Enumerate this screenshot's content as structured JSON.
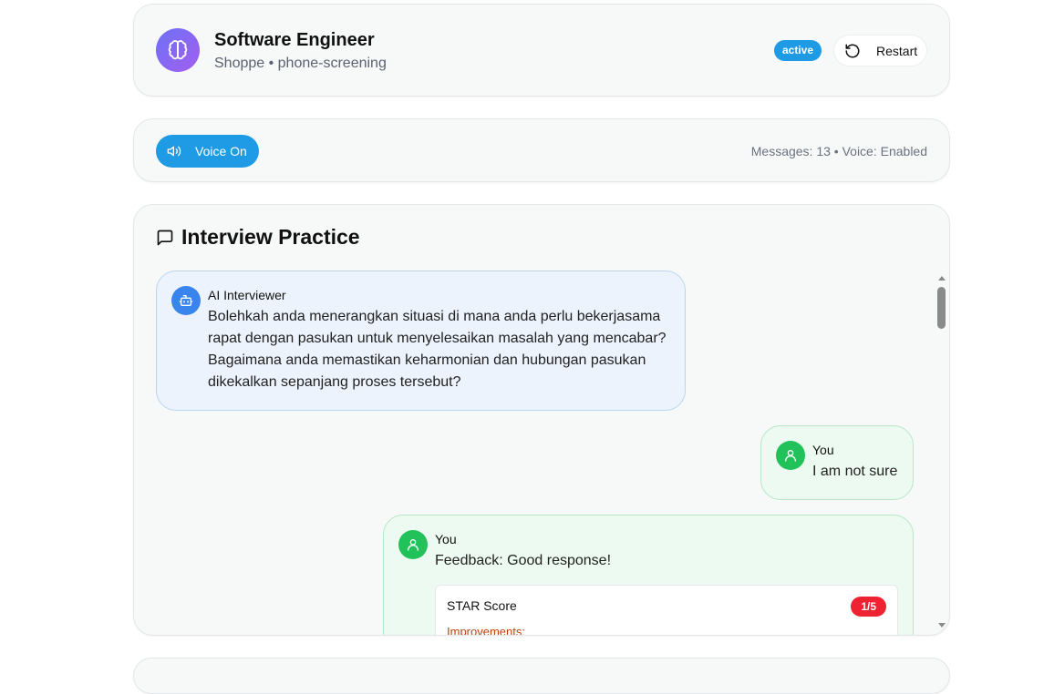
{
  "header": {
    "title": "Software Engineer",
    "subtitle": "Shoppe • phone-screening",
    "status": "active",
    "restart_label": "Restart"
  },
  "voice": {
    "button_label": "Voice On",
    "stats": "Messages: 13 • Voice: Enabled"
  },
  "interview": {
    "title": "Interview Practice",
    "messages": [
      {
        "sender": "AI Interviewer",
        "text": "Bolehkah anda menerangkan situasi di mana anda perlu bekerjasama rapat dengan pasukan untuk menyelesaikan masalah yang mencabar? Bagaimana anda memastikan keharmonian dan hubungan pasukan dikekalkan sepanjang proses tersebut?"
      },
      {
        "sender": "You",
        "text": "I am not sure"
      },
      {
        "sender": "You",
        "text": "Feedback: Good response!",
        "star_label": "STAR Score",
        "star_score": "1/5",
        "improvements_label": "Improvements:"
      }
    ]
  },
  "colors": {
    "accent": "#1e9be4",
    "ai_avatar": "#3a84ee",
    "user_avatar": "#22c25b",
    "score_badge": "#ee2231"
  },
  "icons": {
    "avatar": "brain-icon",
    "restart": "rotate-ccw-icon",
    "voice": "volume-icon",
    "title": "message-square-icon",
    "ai": "bot-icon",
    "user": "user-icon"
  }
}
